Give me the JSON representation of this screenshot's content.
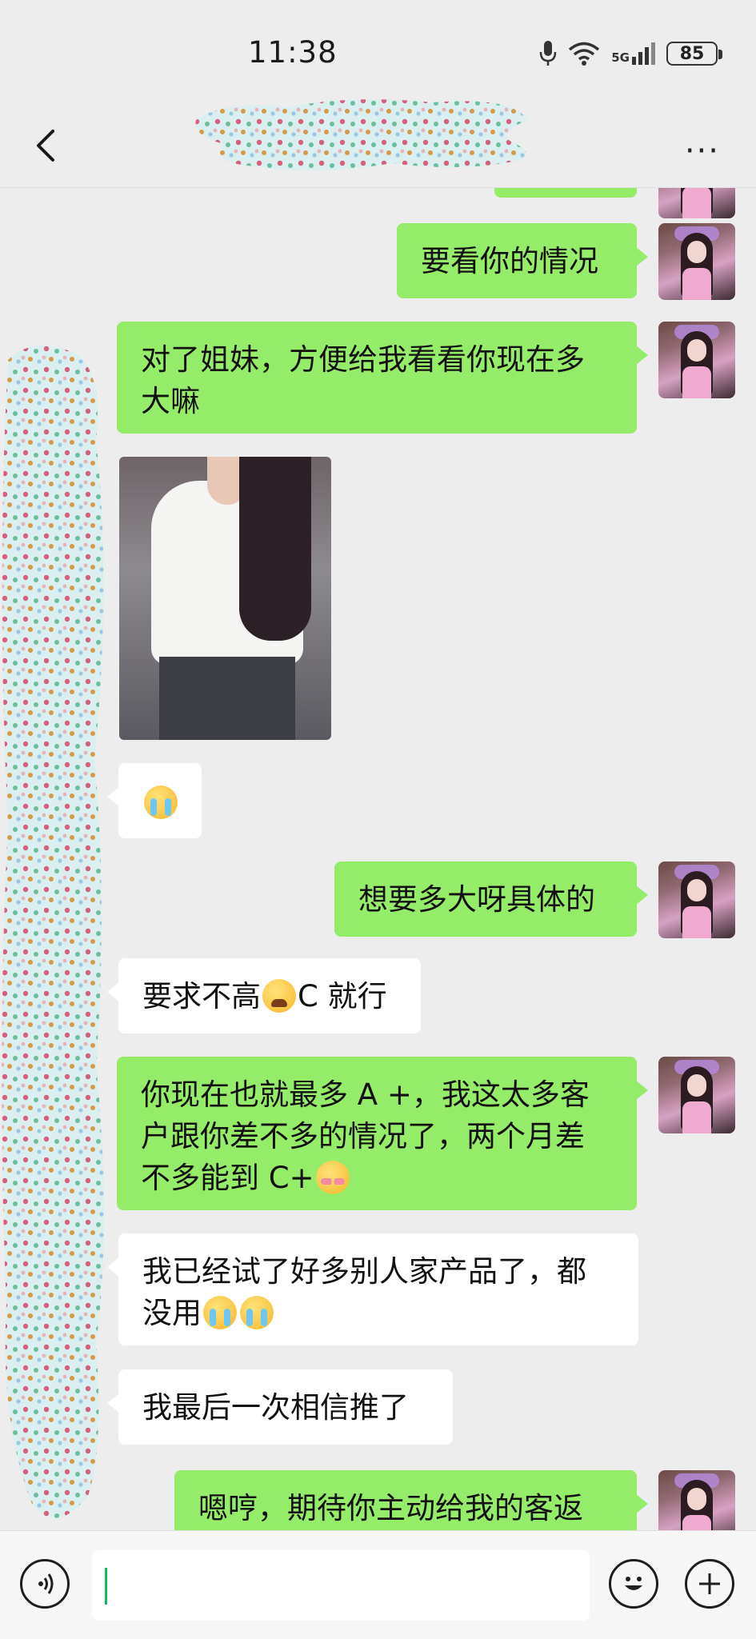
{
  "status_bar": {
    "time": "11:38",
    "network": "5G",
    "battery": "85"
  },
  "header": {
    "more_label": "···"
  },
  "messages": [
    {
      "side": "me",
      "text": "要看你的情况"
    },
    {
      "side": "me",
      "text": "对了姐妹，方便给我看看你现在多大嘛"
    },
    {
      "side": "them",
      "type": "photo"
    },
    {
      "side": "them",
      "type": "emoji",
      "emoji": "crying-face"
    },
    {
      "side": "me",
      "text": "想要多大呀具体的"
    },
    {
      "side": "them",
      "text_a": "要求不高",
      "emoji": "tired-face",
      "text_b": "C 就行"
    },
    {
      "side": "me",
      "text_a": "你现在也就最多 A +，我这太多客户跟你差不多的情况了，两个月差不多能到 C+",
      "emoji": "shy-face"
    },
    {
      "side": "them",
      "text_a": "我已经试了好多别人家产品了，都没用",
      "emoji": "crying-face"
    },
    {
      "side": "them",
      "text": "我最后一次相信推了"
    },
    {
      "side": "me",
      "text": "嗯哼，期待你主动给我的客返"
    }
  ],
  "input_bar": {
    "voice_icon": "voice-icon",
    "emoji_icon": "emoji-icon",
    "add_icon": "plus-icon"
  },
  "colors": {
    "my_bubble": "#95ec69",
    "their_bubble": "#ffffff",
    "background": "#ededed",
    "caret": "#07c160"
  }
}
